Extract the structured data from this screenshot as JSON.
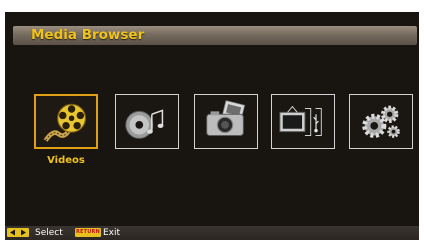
{
  "header": {
    "title": "Media Browser"
  },
  "tiles": [
    {
      "label": "Videos",
      "icon": "film-reel-icon",
      "selected": true
    },
    {
      "label": "",
      "icon": "music-cd-icon",
      "selected": false
    },
    {
      "label": "",
      "icon": "camera-photos-icon",
      "selected": false
    },
    {
      "label": "",
      "icon": "tv-usb-icon",
      "selected": false
    },
    {
      "label": "",
      "icon": "settings-gears-icon",
      "selected": false
    }
  ],
  "footer": {
    "select_label": "Select",
    "return_key_label": "RETURN",
    "exit_label": "Exit"
  },
  "colors": {
    "accent": "#f0c31c",
    "selection_border": "#e0a014",
    "background": "#181410"
  }
}
